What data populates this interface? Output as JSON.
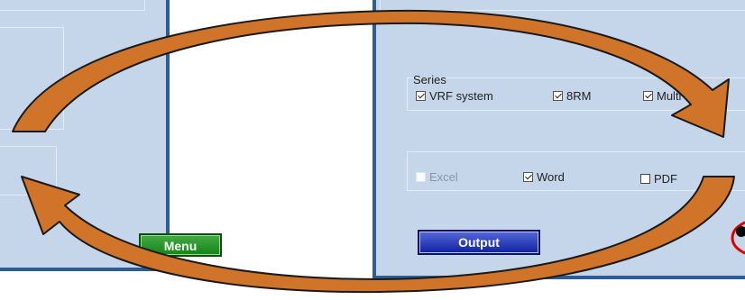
{
  "series": {
    "title": "Series",
    "options": [
      {
        "label": "VRF system",
        "checked": true
      },
      {
        "label": "8RM",
        "checked": true
      },
      {
        "label": "Multi system",
        "checked": true
      }
    ]
  },
  "format": {
    "options": [
      {
        "label": "Excel",
        "checked": false,
        "enabled": false
      },
      {
        "label": "Word",
        "checked": true,
        "enabled": true
      },
      {
        "label": "PDF",
        "checked": false,
        "enabled": true
      }
    ]
  },
  "buttons": {
    "menu_label": "Menu",
    "output_label": "Output"
  },
  "colors": {
    "panel_bg": "#c5d6ea",
    "panel_border": "#2d5d96",
    "menu_button": "#138613",
    "output_button": "#0f20a0",
    "arrow_fill": "#d0742a",
    "highlight_circle": "#e00000"
  }
}
